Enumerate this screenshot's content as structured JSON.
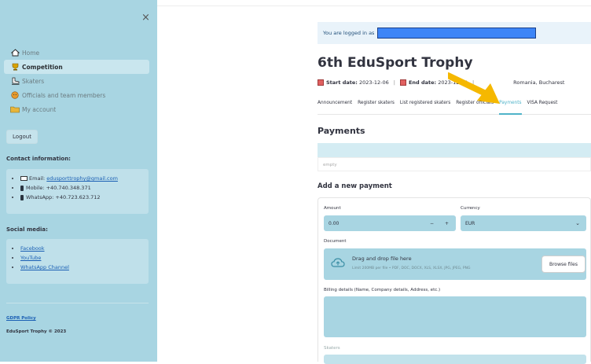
{
  "sidebar": {
    "close_label": "×",
    "nav": [
      {
        "label": "Home",
        "icon": "home-icon"
      },
      {
        "label": "Competition",
        "icon": "trophy-icon"
      },
      {
        "label": "Skaters",
        "icon": "skate-icon"
      },
      {
        "label": "Officials and team members",
        "icon": "officials-icon"
      },
      {
        "label": "My account",
        "icon": "folder-icon"
      }
    ],
    "logout_label": "Logout",
    "contact_title": "Contact information:",
    "contact": {
      "email_label": "Email: ",
      "email": "edusporttrophy@gmail.com",
      "mobile": "Mobile: +40.740.348.371",
      "whatsapp": "WhatsApp: +40.723.623.712"
    },
    "social_title": "Social media:",
    "social": [
      "Facebook",
      "YouTube",
      "WhatsApp Channel"
    ],
    "gdpr": "GDPR Policy",
    "copyright": "EduSport Trophy © 2023"
  },
  "main": {
    "logged_in_text": "You are logged in as",
    "title": "6th EduSport Trophy",
    "start_label": "Start date:",
    "start_date": "2023-12-06",
    "end_label": "End date:",
    "end_date": "2023-12-10",
    "location": "Romania, Bucharest",
    "tabs": [
      "Announcement",
      "Register skaters",
      "List registered skaters",
      "Register officials",
      "Payments",
      "VISA Request"
    ],
    "active_tab": "Payments",
    "payments_heading": "Payments",
    "empty_text": "empty",
    "add_heading": "Add a new payment",
    "amount_label": "Amount",
    "amount_value": "0.00",
    "minus": "−",
    "plus": "+",
    "currency_label": "Currency",
    "currency_value": "EUR",
    "document_label": "Document",
    "drag_text": "Drag and drop file here",
    "limit_text": "Limit 200MB per file • PDF, DOC, DOCX, XLS, XLSX, JPG, JPEG, PNG",
    "browse_label": "Browse files",
    "billing_label": "Billing details (Name, Company details, Address, etc.)",
    "skaters_label": "Skaters"
  },
  "colors": {
    "sidebar": "#a8d5e2",
    "accent": "#4fb3c9",
    "arrow": "#f5b800",
    "redact": "#3d85f7"
  }
}
